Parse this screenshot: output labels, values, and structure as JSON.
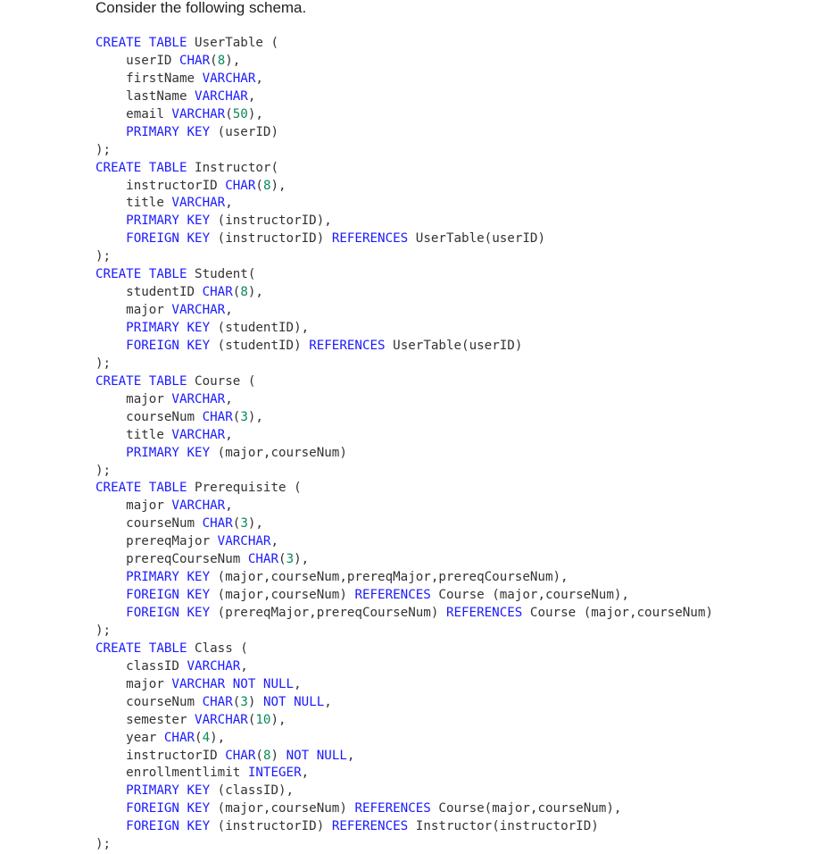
{
  "intro": "Consider the following schema.",
  "colors": {
    "keyword": "#1a1aff",
    "number": "#0a8a5a",
    "text": "#333333"
  },
  "code_lines": [
    [
      [
        "k",
        "CREATE TABLE"
      ],
      [
        "t",
        " UserTable ("
      ]
    ],
    [
      [
        "t",
        "    userID "
      ],
      [
        "k",
        "CHAR"
      ],
      [
        "t",
        "("
      ],
      [
        "n",
        "8"
      ],
      [
        "t",
        "),"
      ]
    ],
    [
      [
        "t",
        "    firstName "
      ],
      [
        "k",
        "VARCHAR"
      ],
      [
        "t",
        ","
      ]
    ],
    [
      [
        "t",
        "    lastName "
      ],
      [
        "k",
        "VARCHAR"
      ],
      [
        "t",
        ","
      ]
    ],
    [
      [
        "t",
        "    email "
      ],
      [
        "k",
        "VARCHAR"
      ],
      [
        "t",
        "("
      ],
      [
        "n",
        "50"
      ],
      [
        "t",
        "),"
      ]
    ],
    [
      [
        "t",
        "    "
      ],
      [
        "k",
        "PRIMARY KEY"
      ],
      [
        "t",
        " (userID)"
      ]
    ],
    [
      [
        "t",
        ");"
      ]
    ],
    [
      [
        "k",
        "CREATE TABLE"
      ],
      [
        "t",
        " Instructor("
      ]
    ],
    [
      [
        "t",
        "    instructorID "
      ],
      [
        "k",
        "CHAR"
      ],
      [
        "t",
        "("
      ],
      [
        "n",
        "8"
      ],
      [
        "t",
        "),"
      ]
    ],
    [
      [
        "t",
        "    title "
      ],
      [
        "k",
        "VARCHAR"
      ],
      [
        "t",
        ","
      ]
    ],
    [
      [
        "t",
        "    "
      ],
      [
        "k",
        "PRIMARY KEY"
      ],
      [
        "t",
        " (instructorID),"
      ]
    ],
    [
      [
        "t",
        "    "
      ],
      [
        "k",
        "FOREIGN KEY"
      ],
      [
        "t",
        " (instructorID) "
      ],
      [
        "k",
        "REFERENCES"
      ],
      [
        "t",
        " UserTable(userID)"
      ]
    ],
    [
      [
        "t",
        ");"
      ]
    ],
    [
      [
        "k",
        "CREATE TABLE"
      ],
      [
        "t",
        " Student("
      ]
    ],
    [
      [
        "t",
        "    studentID "
      ],
      [
        "k",
        "CHAR"
      ],
      [
        "t",
        "("
      ],
      [
        "n",
        "8"
      ],
      [
        "t",
        "),"
      ]
    ],
    [
      [
        "t",
        "    major "
      ],
      [
        "k",
        "VARCHAR"
      ],
      [
        "t",
        ","
      ]
    ],
    [
      [
        "t",
        "    "
      ],
      [
        "k",
        "PRIMARY KEY"
      ],
      [
        "t",
        " (studentID),"
      ]
    ],
    [
      [
        "t",
        "    "
      ],
      [
        "k",
        "FOREIGN KEY"
      ],
      [
        "t",
        " (studentID) "
      ],
      [
        "k",
        "REFERENCES"
      ],
      [
        "t",
        " UserTable(userID)"
      ]
    ],
    [
      [
        "t",
        ");"
      ]
    ],
    [
      [
        "k",
        "CREATE TABLE"
      ],
      [
        "t",
        " Course ("
      ]
    ],
    [
      [
        "t",
        "    major "
      ],
      [
        "k",
        "VARCHAR"
      ],
      [
        "t",
        ","
      ]
    ],
    [
      [
        "t",
        "    courseNum "
      ],
      [
        "k",
        "CHAR"
      ],
      [
        "t",
        "("
      ],
      [
        "n",
        "3"
      ],
      [
        "t",
        "),"
      ]
    ],
    [
      [
        "t",
        "    title "
      ],
      [
        "k",
        "VARCHAR"
      ],
      [
        "t",
        ","
      ]
    ],
    [
      [
        "t",
        "    "
      ],
      [
        "k",
        "PRIMARY KEY"
      ],
      [
        "t",
        " (major,courseNum)"
      ]
    ],
    [
      [
        "t",
        ");"
      ]
    ],
    [
      [
        "k",
        "CREATE TABLE"
      ],
      [
        "t",
        " Prerequisite ("
      ]
    ],
    [
      [
        "t",
        "    major "
      ],
      [
        "k",
        "VARCHAR"
      ],
      [
        "t",
        ","
      ]
    ],
    [
      [
        "t",
        "    courseNum "
      ],
      [
        "k",
        "CHAR"
      ],
      [
        "t",
        "("
      ],
      [
        "n",
        "3"
      ],
      [
        "t",
        "),"
      ]
    ],
    [
      [
        "t",
        "    prereqMajor "
      ],
      [
        "k",
        "VARCHAR"
      ],
      [
        "t",
        ","
      ]
    ],
    [
      [
        "t",
        "    prereqCourseNum "
      ],
      [
        "k",
        "CHAR"
      ],
      [
        "t",
        "("
      ],
      [
        "n",
        "3"
      ],
      [
        "t",
        "),"
      ]
    ],
    [
      [
        "t",
        "    "
      ],
      [
        "k",
        "PRIMARY KEY"
      ],
      [
        "t",
        " (major,courseNum,prereqMajor,prereqCourseNum),"
      ]
    ],
    [
      [
        "t",
        "    "
      ],
      [
        "k",
        "FOREIGN KEY"
      ],
      [
        "t",
        " (major,courseNum) "
      ],
      [
        "k",
        "REFERENCES"
      ],
      [
        "t",
        " Course (major,courseNum),"
      ]
    ],
    [
      [
        "t",
        "    "
      ],
      [
        "k",
        "FOREIGN KEY"
      ],
      [
        "t",
        " (prereqMajor,prereqCourseNum) "
      ],
      [
        "k",
        "REFERENCES"
      ],
      [
        "t",
        " Course (major,courseNum)"
      ]
    ],
    [
      [
        "t",
        ");"
      ]
    ],
    [
      [
        "k",
        "CREATE TABLE"
      ],
      [
        "t",
        " Class ("
      ]
    ],
    [
      [
        "t",
        "    classID "
      ],
      [
        "k",
        "VARCHAR"
      ],
      [
        "t",
        ","
      ]
    ],
    [
      [
        "t",
        "    major "
      ],
      [
        "k",
        "VARCHAR NOT NULL"
      ],
      [
        "t",
        ","
      ]
    ],
    [
      [
        "t",
        "    courseNum "
      ],
      [
        "k",
        "CHAR"
      ],
      [
        "t",
        "("
      ],
      [
        "n",
        "3"
      ],
      [
        "t",
        ") "
      ],
      [
        "k",
        "NOT NULL"
      ],
      [
        "t",
        ","
      ]
    ],
    [
      [
        "t",
        "    semester "
      ],
      [
        "k",
        "VARCHAR"
      ],
      [
        "t",
        "("
      ],
      [
        "n",
        "10"
      ],
      [
        "t",
        "),"
      ]
    ],
    [
      [
        "t",
        "    year "
      ],
      [
        "k",
        "CHAR"
      ],
      [
        "t",
        "("
      ],
      [
        "n",
        "4"
      ],
      [
        "t",
        "),"
      ]
    ],
    [
      [
        "t",
        "    instructorID "
      ],
      [
        "k",
        "CHAR"
      ],
      [
        "t",
        "("
      ],
      [
        "n",
        "8"
      ],
      [
        "t",
        ") "
      ],
      [
        "k",
        "NOT NULL"
      ],
      [
        "t",
        ","
      ]
    ],
    [
      [
        "t",
        "    enrollmentlimit "
      ],
      [
        "k",
        "INTEGER"
      ],
      [
        "t",
        ","
      ]
    ],
    [
      [
        "t",
        "    "
      ],
      [
        "k",
        "PRIMARY KEY"
      ],
      [
        "t",
        " (classID),"
      ]
    ],
    [
      [
        "t",
        "    "
      ],
      [
        "k",
        "FOREIGN KEY"
      ],
      [
        "t",
        " (major,courseNum) "
      ],
      [
        "k",
        "REFERENCES"
      ],
      [
        "t",
        " Course(major,courseNum),"
      ]
    ],
    [
      [
        "t",
        "    "
      ],
      [
        "k",
        "FOREIGN KEY"
      ],
      [
        "t",
        " (instructorID) "
      ],
      [
        "k",
        "REFERENCES"
      ],
      [
        "t",
        " Instructor(instructorID)"
      ]
    ],
    [
      [
        "t",
        ");"
      ]
    ]
  ]
}
